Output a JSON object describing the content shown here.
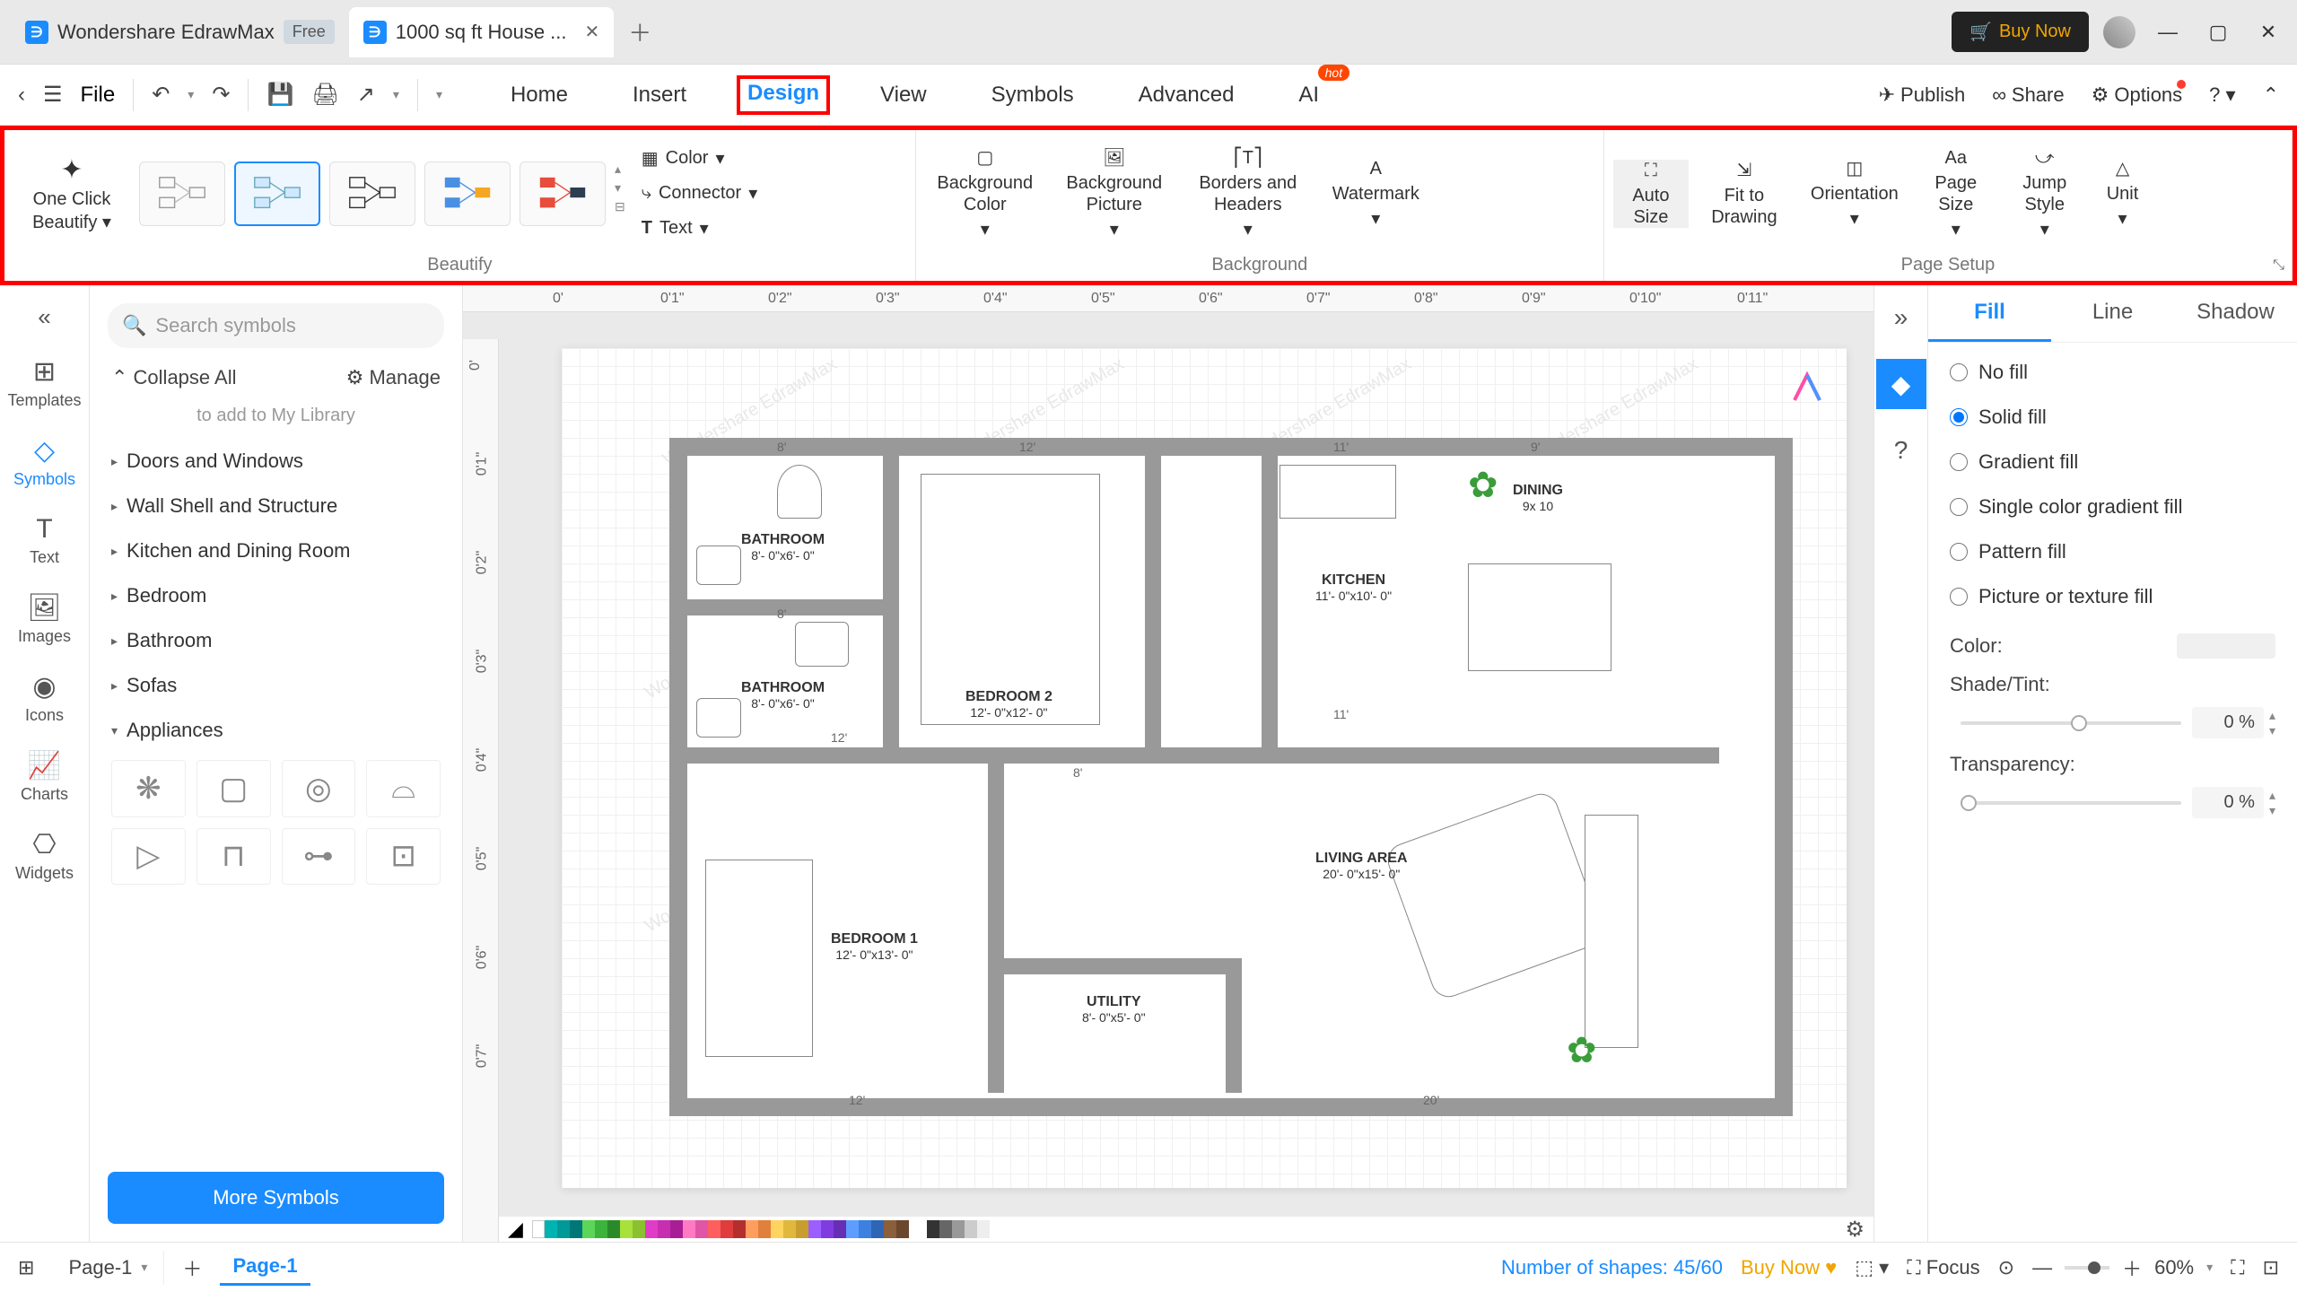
{
  "titlebar": {
    "tab1_title": "Wondershare EdrawMax",
    "free_badge": "Free",
    "tab2_title": "1000 sq ft House ...",
    "buy_now": "Buy Now"
  },
  "toolbar": {
    "file": "File",
    "tabs": {
      "home": "Home",
      "insert": "Insert",
      "design": "Design",
      "view": "View",
      "symbols": "Symbols",
      "advanced": "Advanced",
      "ai": "AI",
      "hot": "hot"
    },
    "right": {
      "publish": "Publish",
      "share": "Share",
      "options": "Options"
    }
  },
  "ribbon": {
    "oneclick_l1": "One Click",
    "oneclick_l2": "Beautify",
    "beautify_label": "Beautify",
    "color": "Color",
    "connector": "Connector",
    "text": "Text",
    "bg_color": "Background Color",
    "bg_picture": "Background Picture",
    "borders": "Borders and Headers",
    "watermark": "Watermark",
    "background_label": "Background",
    "auto_size": "Auto Size",
    "fit": "Fit to Drawing",
    "orientation": "Orientation",
    "page_size": "Page Size",
    "jump": "Jump Style",
    "unit": "Unit",
    "page_setup_label": "Page Setup"
  },
  "sidebar_icons": {
    "templates": "Templates",
    "symbols": "Symbols",
    "text": "Text",
    "images": "Images",
    "icons": "Icons",
    "charts": "Charts",
    "widgets": "Widgets"
  },
  "symbol_panel": {
    "search_placeholder": "Search symbols",
    "collapse": "Collapse All",
    "manage": "Manage",
    "hint": "to add to My Library",
    "cats": {
      "doors": "Doors and Windows",
      "wall": "Wall Shell and Structure",
      "kitchen": "Kitchen and Dining Room",
      "bedroom": "Bedroom",
      "bathroom": "Bathroom",
      "sofas": "Sofas",
      "appliances": "Appliances"
    },
    "more": "More Symbols"
  },
  "ruler_h": [
    "0'",
    "0'1\"",
    "0'2\"",
    "0'3\"",
    "0'4\"",
    "0'5\"",
    "0'6\"",
    "0'7\"",
    "0'8\"",
    "0'9\"",
    "0'10\"",
    "0'11\""
  ],
  "ruler_v": [
    "0'",
    "0'1\"",
    "0'2\"",
    "0'3\"",
    "0'4\"",
    "0'5\"",
    "0'6\"",
    "0'7\""
  ],
  "floorplan": {
    "bathroom1": "BATHROOM",
    "bathroom1_dim": "8'- 0\"x6'- 0\"",
    "bathroom2": "BATHROOM",
    "bathroom2_dim": "8'- 0\"x6'- 0\"",
    "bedroom1": "BEDROOM 1",
    "bedroom1_dim": "12'- 0\"x13'- 0\"",
    "bedroom2": "BEDROOM 2",
    "bedroom2_dim": "12'- 0\"x12'- 0\"",
    "utility": "UTILITY",
    "utility_dim": "8'- 0\"x5'- 0\"",
    "kitchen": "KITCHEN",
    "kitchen_dim": "11'- 0\"x10'- 0\"",
    "dining": "DINING",
    "dining_dim": "9x 10",
    "living": "LIVING AREA",
    "living_dim": "20'- 0\"x15'- 0\"",
    "d8": "8'",
    "d12": "12'",
    "d11": "11'",
    "d9": "9'",
    "d20": "20'"
  },
  "watermark": "Wondershare EdrawMax",
  "right_panel": {
    "tabs": {
      "fill": "Fill",
      "line": "Line",
      "shadow": "Shadow"
    },
    "nofill": "No fill",
    "solid": "Solid fill",
    "gradient": "Gradient fill",
    "single_grad": "Single color gradient fill",
    "pattern": "Pattern fill",
    "picture": "Picture or texture fill",
    "color": "Color:",
    "shade": "Shade/Tint:",
    "shade_val": "0 %",
    "transparency": "Transparency:",
    "trans_val": "0 %"
  },
  "bottombar": {
    "page_dd": "Page-1",
    "page_tab": "Page-1",
    "shapes": "Number of shapes: 45/60",
    "buy": "Buy Now",
    "focus": "Focus",
    "zoom": "60%"
  }
}
